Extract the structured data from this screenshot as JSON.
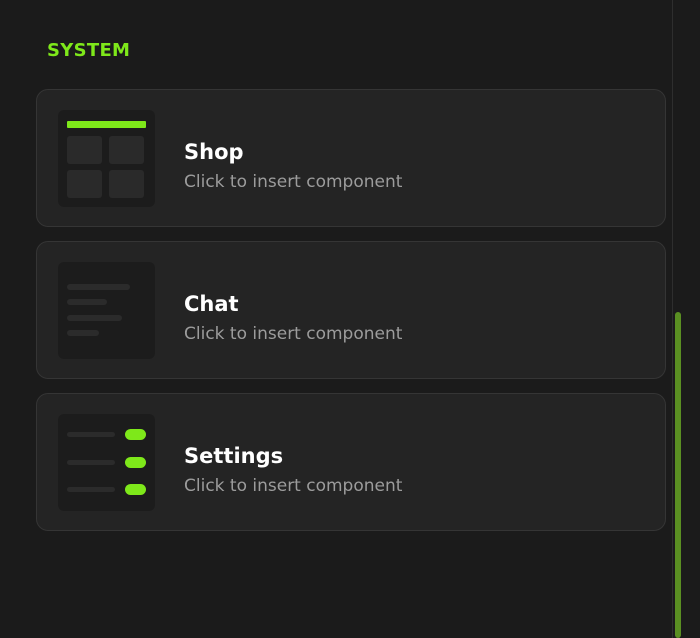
{
  "section": {
    "title": "SYSTEM"
  },
  "cards": [
    {
      "title": "Shop",
      "subtitle": "Click to insert component",
      "icon": "shop-grid-icon"
    },
    {
      "title": "Chat",
      "subtitle": "Click to insert component",
      "icon": "chat-lines-icon"
    },
    {
      "title": "Settings",
      "subtitle": "Click to insert component",
      "icon": "settings-toggles-icon"
    }
  ],
  "colors": {
    "accent": "#7ee81a",
    "background": "#1b1b1b",
    "card": "#242424",
    "scrollbar": "#5a8f22"
  }
}
